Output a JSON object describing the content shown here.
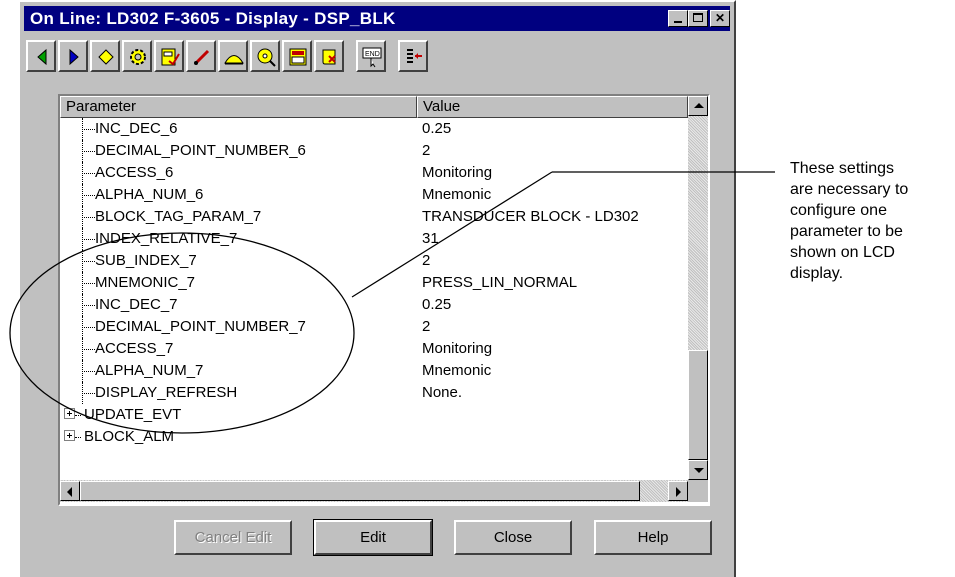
{
  "window": {
    "title": "On Line: LD302 F-3605 - Display - DSP_BLK",
    "controls": [
      "minimize",
      "maximize",
      "close"
    ]
  },
  "toolbar": {
    "icons": [
      "back-arrow-icon",
      "forward-arrow-icon",
      "diamond-icon",
      "gear-icon",
      "gauge-check-icon",
      "pen-icon",
      "mountain-icon",
      "disc-icon",
      "calculator-icon",
      "scroll-icon",
      "end-cursor-icon",
      "list-arrow-icon"
    ],
    "colors": {
      "green": "#00a000",
      "blue": "#0000c0",
      "yellow": "#ffff00",
      "red": "#c00000"
    }
  },
  "table": {
    "headers": {
      "parameter": "Parameter",
      "value": "Value"
    },
    "rows": [
      {
        "name": "INC_DEC_6",
        "value": "0.25"
      },
      {
        "name": "DECIMAL_POINT_NUMBER_6",
        "value": "2"
      },
      {
        "name": "ACCESS_6",
        "value": "Monitoring"
      },
      {
        "name": "ALPHA_NUM_6",
        "value": "Mnemonic"
      },
      {
        "name": "BLOCK_TAG_PARAM_7",
        "value": "TRANSDUCER BLOCK - LD302"
      },
      {
        "name": "INDEX_RELATIVE_7",
        "value": "31"
      },
      {
        "name": "SUB_INDEX_7",
        "value": "2"
      },
      {
        "name": "MNEMONIC_7",
        "value": "PRESS_LIN_NORMAL"
      },
      {
        "name": "INC_DEC_7",
        "value": "0.25"
      },
      {
        "name": "DECIMAL_POINT_NUMBER_7",
        "value": "2"
      },
      {
        "name": "ACCESS_7",
        "value": "Monitoring"
      },
      {
        "name": "ALPHA_NUM_7",
        "value": "Mnemonic"
      },
      {
        "name": "DISPLAY_REFRESH",
        "value": "None."
      },
      {
        "name": "UPDATE_EVT",
        "value": "",
        "expandable": true
      },
      {
        "name": "BLOCK_ALM",
        "value": "",
        "expandable": true
      }
    ]
  },
  "buttons": {
    "cancel_edit": "Cancel Edit",
    "edit": "Edit",
    "close": "Close",
    "help": "Help"
  },
  "annotation": {
    "text": "These settings\nare necessary to\nconfigure one\nparameter to be\nshown on LCD\ndisplay."
  }
}
